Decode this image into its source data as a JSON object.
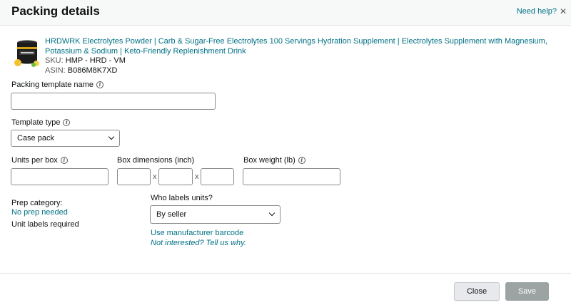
{
  "header": {
    "title": "Packing details",
    "help_link": "Need help?"
  },
  "product": {
    "image": "electrolytes-tub",
    "title": "HRDWRK Electrolytes Powder | Carb & Sugar-Free Electrolytes 100 Servings Hydration Supplement | Electrolytes Supplement with Magnesium, Potassium & Sodium | Keto-Friendly Replenishment Drink",
    "sku_label": "SKU:",
    "sku_value": "HMP - HRD - VM",
    "asin_label": "ASIN:",
    "asin_value": "B086M8K7XD"
  },
  "form": {
    "packing_template_name": {
      "label": "Packing template name",
      "value": ""
    },
    "template_type": {
      "label": "Template type",
      "selected": "Case pack"
    },
    "units_per_box": {
      "label": "Units per box",
      "value": ""
    },
    "box_dimensions": {
      "label": "Box dimensions (inch)",
      "separator": "x",
      "length": "",
      "width": "",
      "height": ""
    },
    "box_weight": {
      "label": "Box weight (lb)",
      "value": ""
    },
    "prep": {
      "category_label": "Prep category:",
      "category_link": "No prep needed",
      "unit_labels": "Unit labels required"
    },
    "who_labels": {
      "label": "Who labels units?",
      "selected": "By seller",
      "manufacturer_link": "Use manufacturer barcode",
      "feedback_link": "Not interested? Tell us why."
    }
  },
  "footer": {
    "close_label": "Close",
    "save_label": "Save"
  },
  "colors": {
    "link": "#007185",
    "save_disabled": "#9ba3a3",
    "header_bg": "#f7f8f8"
  }
}
